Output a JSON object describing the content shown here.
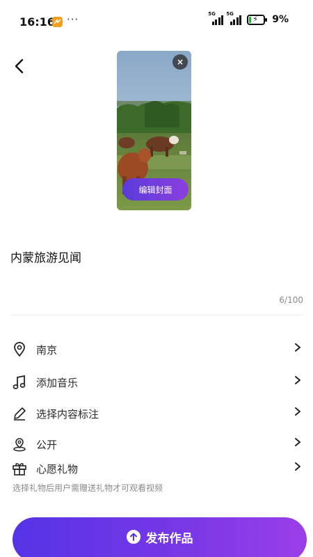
{
  "status_bar": {
    "time": "16:16",
    "dots": "···",
    "signal1_label": "5G",
    "signal2_label": "5G",
    "battery_percent": "9%",
    "battery_level": 0.09
  },
  "cover": {
    "close_icon": "×",
    "edit_label": "编辑封面"
  },
  "post": {
    "title": "内蒙旅游见闻",
    "char_count": "6/100"
  },
  "options": {
    "location": "南京",
    "music": "添加音乐",
    "tag": "选择内容标注",
    "privacy": "公开",
    "gift": "心愿礼物",
    "gift_hint": "选择礼物后用户需赠送礼物才可观看视频"
  },
  "publish": {
    "label": "发布作品"
  },
  "colors": {
    "accent_start": "#5533e6",
    "accent_end": "#9a3fe8",
    "battery_charging": "#1fb33a"
  }
}
